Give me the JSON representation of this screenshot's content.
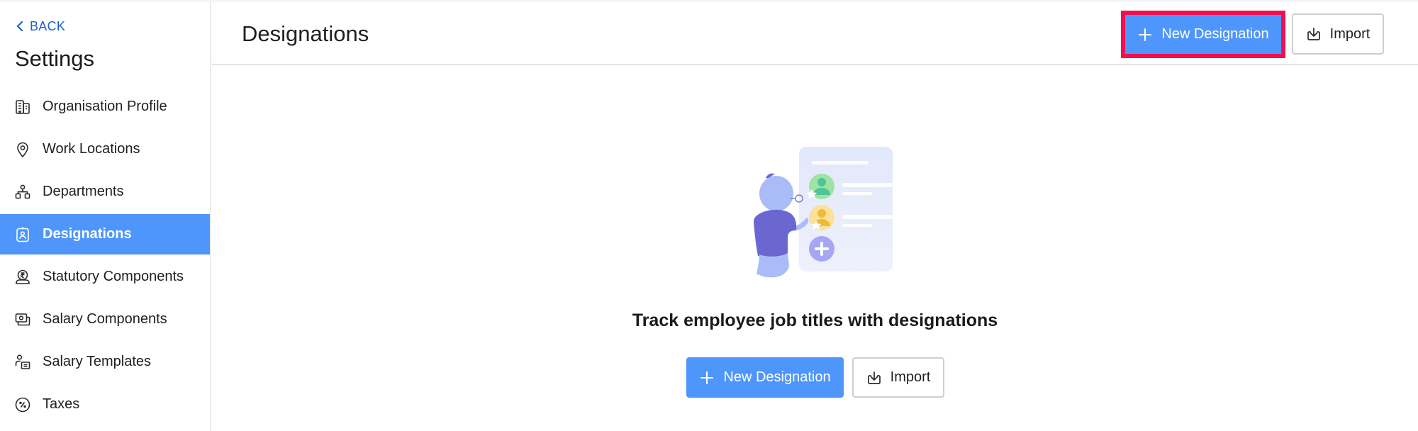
{
  "sidebar": {
    "back_label": "BACK",
    "title": "Settings",
    "items": [
      {
        "label": "Organisation Profile",
        "icon": "building-icon",
        "active": false
      },
      {
        "label": "Work Locations",
        "icon": "location-pin-icon",
        "active": false
      },
      {
        "label": "Departments",
        "icon": "org-chart-icon",
        "active": false
      },
      {
        "label": "Designations",
        "icon": "id-badge-icon",
        "active": true
      },
      {
        "label": "Statutory Components",
        "icon": "rupee-hand-icon",
        "active": false
      },
      {
        "label": "Salary Components",
        "icon": "cash-stack-icon",
        "active": false
      },
      {
        "label": "Salary Templates",
        "icon": "user-template-icon",
        "active": false
      },
      {
        "label": "Taxes",
        "icon": "percent-circle-icon",
        "active": false
      }
    ]
  },
  "header": {
    "title": "Designations",
    "new_button_label": "New Designation",
    "import_button_label": "Import"
  },
  "empty_state": {
    "heading": "Track employee job titles with designations",
    "new_button_label": "New Designation",
    "import_button_label": "Import"
  },
  "colors": {
    "accent": "#4e96fb",
    "link": "#1f62c9",
    "highlight": "#f0104f"
  }
}
